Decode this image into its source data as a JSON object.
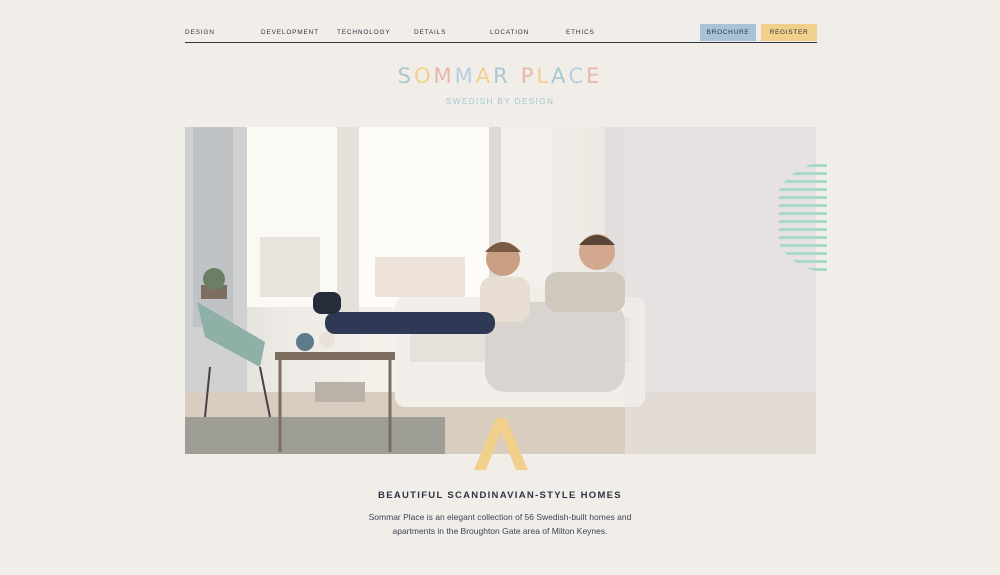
{
  "nav": {
    "items": [
      "Design",
      "Development",
      "Technology",
      "Details",
      "Location",
      "Ethics"
    ],
    "brochure_label": "Brochure",
    "register_label": "Register"
  },
  "brand": {
    "letters": [
      "S",
      "O",
      "M",
      "M",
      "A",
      "R",
      " ",
      "P",
      "L",
      "A",
      "C",
      "E"
    ],
    "tagline": "SWEDISH BY DESIGN"
  },
  "hero": {
    "image_alt": "Couple relaxing on a sofa in a bright Scandinavian living room"
  },
  "intro": {
    "headline": "BEAUTIFUL SCANDINAVIAN-STYLE HOMES",
    "description": "Sommar Place is an elegant collection of 56 Swedish-built homes and apartments in the Broughton Gate area of Milton Keynes."
  },
  "colors": {
    "background": "#f1eeea",
    "text": "#2e3440",
    "brochure": "#a9c2d6",
    "register": "#f1d08c",
    "accent_mint": "#a8d8cb",
    "accent_gold": "#f1d08c"
  }
}
